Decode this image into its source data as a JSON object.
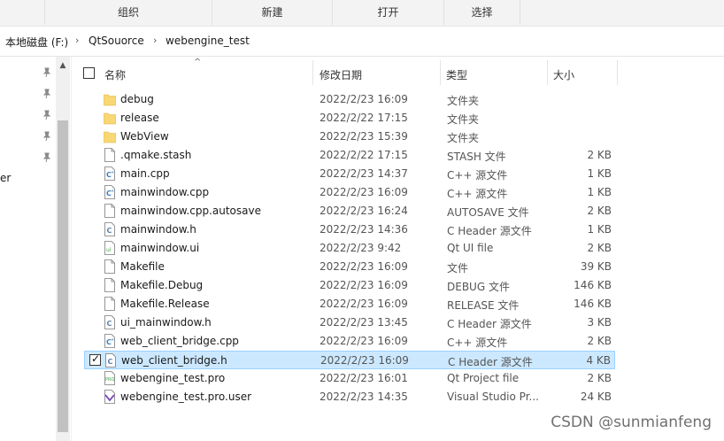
{
  "ribbon": {
    "groups": [
      "组织",
      "新建",
      "打开",
      "选择"
    ]
  },
  "address": {
    "segments": [
      "本地磁盘 (F:)",
      "QtSouorce",
      "webengine_test"
    ],
    "separator": "›"
  },
  "nav": {
    "partial_label": "er"
  },
  "columns": {
    "name": "名称",
    "date": "修改日期",
    "type": "类型",
    "size": "大小"
  },
  "files": [
    {
      "name": "debug",
      "date": "2022/2/23 16:09",
      "type": "文件夹",
      "size": "",
      "icon": "folder-icon"
    },
    {
      "name": "release",
      "date": "2022/2/22 17:15",
      "type": "文件夹",
      "size": "",
      "icon": "folder-icon"
    },
    {
      "name": "WebView",
      "date": "2022/2/23 15:39",
      "type": "文件夹",
      "size": "",
      "icon": "folder-icon"
    },
    {
      "name": ".qmake.stash",
      "date": "2022/2/22 17:15",
      "type": "STASH 文件",
      "size": "2 KB",
      "icon": "file-icon"
    },
    {
      "name": "main.cpp",
      "date": "2022/2/23 14:37",
      "type": "C++ 源文件",
      "size": "1 KB",
      "icon": "cpp-file-icon"
    },
    {
      "name": "mainwindow.cpp",
      "date": "2022/2/23 16:09",
      "type": "C++ 源文件",
      "size": "1 KB",
      "icon": "cpp-file-icon"
    },
    {
      "name": "mainwindow.cpp.autosave",
      "date": "2022/2/23 16:24",
      "type": "AUTOSAVE 文件",
      "size": "2 KB",
      "icon": "file-icon"
    },
    {
      "name": "mainwindow.h",
      "date": "2022/2/23 14:36",
      "type": "C Header 源文件",
      "size": "1 KB",
      "icon": "header-file-icon"
    },
    {
      "name": "mainwindow.ui",
      "date": "2022/2/23 9:42",
      "type": "Qt UI file",
      "size": "2 KB",
      "icon": "ui-file-icon"
    },
    {
      "name": "Makefile",
      "date": "2022/2/23 16:09",
      "type": "文件",
      "size": "39 KB",
      "icon": "file-icon"
    },
    {
      "name": "Makefile.Debug",
      "date": "2022/2/23 16:09",
      "type": "DEBUG 文件",
      "size": "146 KB",
      "icon": "file-icon"
    },
    {
      "name": "Makefile.Release",
      "date": "2022/2/23 16:09",
      "type": "RELEASE 文件",
      "size": "146 KB",
      "icon": "file-icon"
    },
    {
      "name": "ui_mainwindow.h",
      "date": "2022/2/23 13:45",
      "type": "C Header 源文件",
      "size": "3 KB",
      "icon": "header-file-icon"
    },
    {
      "name": "web_client_bridge.cpp",
      "date": "2022/2/23 16:09",
      "type": "C++ 源文件",
      "size": "2 KB",
      "icon": "cpp-file-icon"
    },
    {
      "name": "web_client_bridge.h",
      "date": "2022/2/23 16:09",
      "type": "C Header 源文件",
      "size": "4 KB",
      "icon": "header-file-icon",
      "selected": true
    },
    {
      "name": "webengine_test.pro",
      "date": "2022/2/23 16:01",
      "type": "Qt Project file",
      "size": "2 KB",
      "icon": "pro-file-icon"
    },
    {
      "name": "webengine_test.pro.user",
      "date": "2022/2/23 14:35",
      "type": "Visual Studio Pr...",
      "size": "24 KB",
      "icon": "user-file-icon"
    }
  ],
  "watermark": "CSDN @sunmianfeng",
  "colors": {
    "selection_bg": "#cce8ff",
    "selection_border": "#99d1ff",
    "folder": "#f8d775",
    "cpp_icon": "#3b7bbf"
  }
}
